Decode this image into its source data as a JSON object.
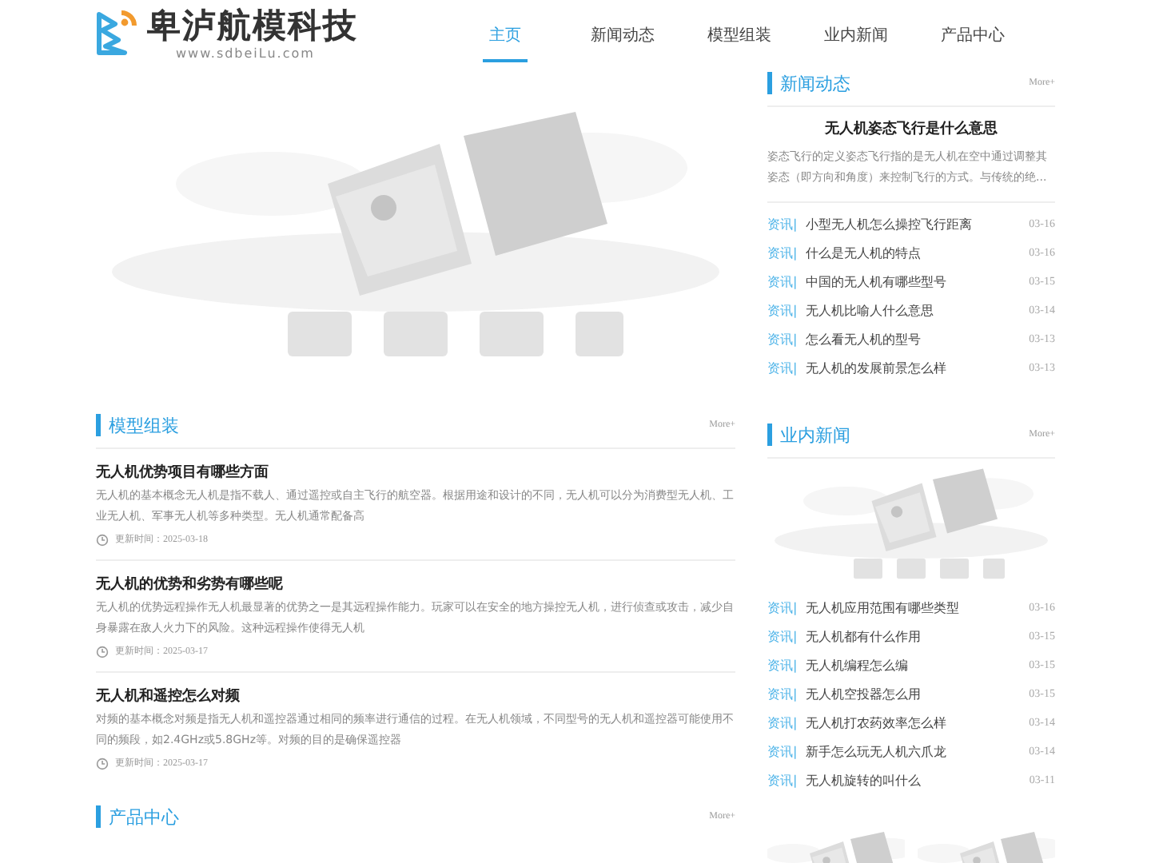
{
  "header": {
    "brand": "卑泸航模科技",
    "domain": "www.sdbeiLu.com"
  },
  "nav": [
    {
      "label": "主页",
      "selected": true
    },
    {
      "label": "新闻动态",
      "selected": false
    },
    {
      "label": "模型组装",
      "selected": false
    },
    {
      "label": "业内新闻",
      "selected": false
    },
    {
      "label": "产品中心",
      "selected": false
    }
  ],
  "assembly": {
    "title": "模型组装",
    "more": "More+",
    "articles": [
      {
        "title": "无人机优势项目有哪些方面",
        "summary": "无人机的基本概念无人机是指不载人、通过遥控或自主飞行的航空器。根据用途和设计的不同，无人机可以分为消费型无人机、工业无人机、军事无人机等多种类型。无人机通常配备高",
        "date": "更新时间：2025-03-18"
      },
      {
        "title": "无人机的优势和劣势有哪些呢",
        "summary": "无人机的优势远程操作无人机最显著的优势之一是其远程操作能力。玩家可以在安全的地方操控无人机，进行侦查或攻击，减少自身暴露在敌人火力下的风险。这种远程操作使得无人机",
        "date": "更新时间：2025-03-17"
      },
      {
        "title": "无人机和遥控怎么对频",
        "summary": "对频的基本概念对频是指无人机和遥控器通过相同的频率进行通信的过程。在无人机领域，不同型号的无人机和遥控器可能使用不同的频段，如2.4GHz或5.8GHz等。对频的目的是确保遥控器",
        "date": "更新时间：2025-03-17"
      }
    ]
  },
  "products": {
    "title": "产品中心",
    "more": "More+"
  },
  "news": {
    "title": "新闻动态",
    "more": "More+",
    "featured": {
      "title": "无人机姿态飞行是什么意思",
      "summary": "姿态飞行的定义姿态飞行指的是无人机在空中通过调整其姿态（即方向和角度）来控制飞行的方式。与传统的绝..."
    },
    "items": [
      {
        "tag": "资讯|",
        "title": "小型无人机怎么操控飞行距离",
        "date": "03-16"
      },
      {
        "tag": "资讯|",
        "title": "什么是无人机的特点",
        "date": "03-16"
      },
      {
        "tag": "资讯|",
        "title": "中国的无人机有哪些型号",
        "date": "03-15"
      },
      {
        "tag": "资讯|",
        "title": "无人机比喻人什么意思",
        "date": "03-14"
      },
      {
        "tag": "资讯|",
        "title": "怎么看无人机的型号",
        "date": "03-13"
      },
      {
        "tag": "资讯|",
        "title": "无人机的发展前景怎么样",
        "date": "03-13"
      }
    ]
  },
  "industry": {
    "title": "业内新闻",
    "more": "More+",
    "items": [
      {
        "tag": "资讯|",
        "title": "无人机应用范围有哪些类型",
        "date": "03-16"
      },
      {
        "tag": "资讯|",
        "title": "无人机都有什么作用",
        "date": "03-15"
      },
      {
        "tag": "资讯|",
        "title": "无人机编程怎么编",
        "date": "03-15"
      },
      {
        "tag": "资讯|",
        "title": "无人机空投器怎么用",
        "date": "03-15"
      },
      {
        "tag": "资讯|",
        "title": "无人机打农药效率怎么样",
        "date": "03-14"
      },
      {
        "tag": "资讯|",
        "title": "新手怎么玩无人机六爪龙",
        "date": "03-14"
      },
      {
        "tag": "资讯|",
        "title": "无人机旋转的叫什么",
        "date": "03-11"
      }
    ]
  }
}
